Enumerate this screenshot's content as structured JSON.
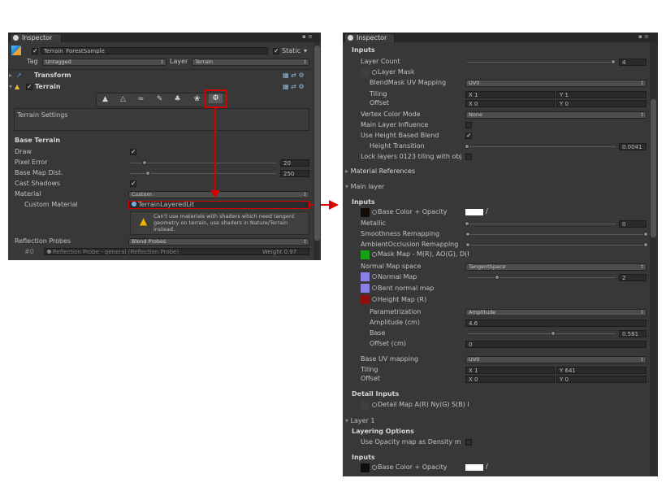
{
  "left": {
    "tab_title": "Inspector",
    "object_name": "Terrain_ForestSample",
    "static_label": "Static",
    "tag_label": "Tag",
    "tag_value": "Untagged",
    "layer_label": "Layer",
    "layer_value": "Terrain",
    "transform_label": "Transform",
    "terrain_label": "Terrain",
    "settings_label": "Terrain Settings",
    "base_terrain_label": "Base Terrain",
    "draw_label": "Draw",
    "pixel_error_label": "Pixel Error",
    "pixel_error_value": "20",
    "pixel_error_level": 0.1,
    "base_map_label": "Base Map Dist.",
    "base_map_value": "250",
    "base_map_level": 0.12,
    "cast_shadows_label": "Cast Shadows",
    "material_label": "Material",
    "material_value": "Custom",
    "custom_material_label": "Custom Material",
    "custom_material_value": "TerrainLayeredLit",
    "warning_text": "Can't use materials with shaders which need tangent geometry on terrain, use shaders in Nature/Terrain instead.",
    "reflection_label": "Reflection Probes",
    "reflection_value": "Blend Probes",
    "probe_index": "#0",
    "probe_name": "Reflection Probe - general (Reflection Probe)",
    "probe_weight": "Weight 0.97"
  },
  "right": {
    "tab_title": "Inspector",
    "inputs_label": "Inputs",
    "layer_count_label": "Layer Count",
    "layer_count_value": "4",
    "layer_count_level": 1.0,
    "layer_mask_label": "Layer Mask",
    "blendmask_uv_label": "BlendMask UV Mapping",
    "blendmask_uv_value": "UV0",
    "tiling_label": "Tiling",
    "offset_label": "Offset",
    "tiling1_x": "X 1",
    "tiling1_y": "Y 1",
    "offset1_x": "X 0",
    "offset1_y": "Y 0",
    "vertex_color_label": "Vertex Color Mode",
    "vertex_color_value": "None",
    "main_influence_label": "Main Layer Influence",
    "height_blend_label": "Use Height Based Blend",
    "height_transition_label": "Height Transition",
    "height_transition_value": "0.0041",
    "height_transition_level": 0.0,
    "lock_layers_label": "Lock layers 0123 tiling with obj",
    "material_refs_label": "Material References",
    "main_layer_label": "Main layer",
    "inputs2_label": "Inputs",
    "base_color_label": "Base Color + Opacity",
    "metallic_label": "Metallic",
    "metallic_value": "0",
    "metallic_level": 0.0,
    "smoothness_label": "Smoothness Remapping",
    "ao_label": "AmbientOcclusion Remapping",
    "mask_map_label": "Mask Map - M(R), AO(G), D(I",
    "normal_space_label": "Normal Map space",
    "normal_space_value": "TangentSpace",
    "normal_map_label": "Normal Map",
    "normal_map_value": "2",
    "normal_map_level": 0.2,
    "bent_normal_label": "Bent normal map",
    "height_map_label": "Height Map (R)",
    "parametrization_label": "Parametrization",
    "parametrization_value": "Amplitude",
    "amplitude_label": "Amplitude (cm)",
    "amplitude_value": "4.6",
    "base_label": "Base",
    "base_value": "0.581",
    "base_level": 0.58,
    "offset_cm_label": "Offset (cm)",
    "offset_cm_value": "0",
    "base_uv_label": "Base UV mapping",
    "base_uv_value": "UV0",
    "tiling2_label": "Tiling",
    "offset2_label": "Offset",
    "tiling2_x": "X 1",
    "tiling2_y": "Y 641",
    "offset2_x": "X 0",
    "offset2_y": "Y 0",
    "detail_inputs_label": "Detail Inputs",
    "detail_map_label": "Detail Map A(R) Ny(G) S(B) l",
    "layer1_label": "Layer 1",
    "layering_options_label": "Layering Options",
    "opacity_density_label": "Use Opacity map as Density m",
    "inputs3_label": "Inputs",
    "base_color2_label": "Base Color + Opacity"
  },
  "colors": {
    "panel_bg": "#383838",
    "highlight_red": "#d40000",
    "mask_green": "#18a018",
    "normal_purple": "#8a80e6",
    "height_red": "#8a1010",
    "warning_yellow": "#f0b400"
  },
  "icons": [
    "inspector-icon",
    "cube-icon",
    "transform-icon",
    "terrain-icon",
    "raise-terrain-icon",
    "paint-height-icon",
    "smooth-height-icon",
    "paint-texture-icon",
    "place-trees-icon",
    "paint-details-icon",
    "terrain-settings-icon",
    "warning-icon",
    "reflection-probe-icon"
  ]
}
